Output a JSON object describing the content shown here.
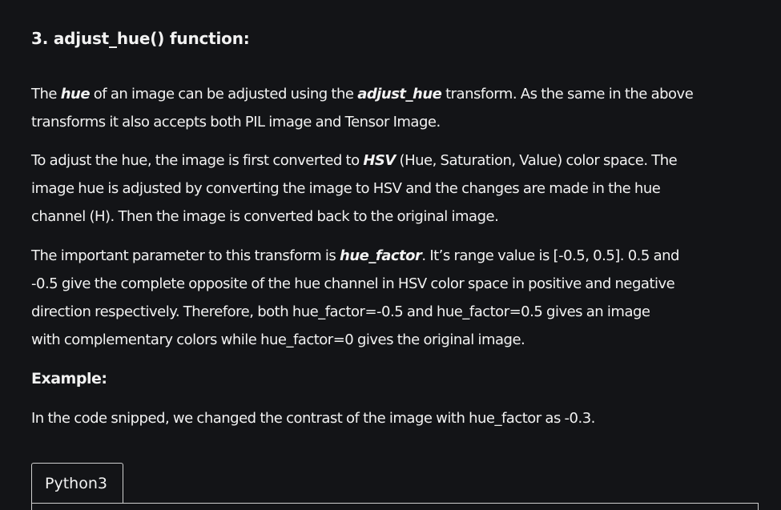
{
  "heading": "3. adjust_hue() function:",
  "para1": {
    "line1": {
      "a": "The ",
      "b": "hue",
      "c": " of an image can be adjusted using the ",
      "d": "adjust_hue",
      "e": " transform. As the same in the above"
    },
    "line2": "transforms it also accepts both PIL image and Tensor Image."
  },
  "para2": {
    "line1": {
      "a": "To adjust the hue, the image is first converted to ",
      "b": "HSV",
      "c": " (Hue, Saturation, Value) color space. The"
    },
    "line2": "image hue is adjusted by converting the image to HSV and the changes are made in the hue",
    "line3": "channel (H). Then the image is converted back to the original image."
  },
  "para3": {
    "line1": {
      "a": "The important parameter to this transform is ",
      "b": "hue_factor",
      "c": ".  It’s range value is [-0.5, 0.5].  0.5 and"
    },
    "line2": "-0.5 give the complete opposite of the hue channel in HSV color space in positive and negative",
    "line3": "direction respectively. Therefore, both hue_factor=-0.5 and hue_factor=0.5 gives an image",
    "line4": "with complementary colors while hue_factor=0 gives the original image."
  },
  "example_label": "Example:",
  "para4": "In the code snipped, we changed the contrast of the image with hue_factor as -0.3.",
  "code_tabs": {
    "active": "Python3"
  }
}
